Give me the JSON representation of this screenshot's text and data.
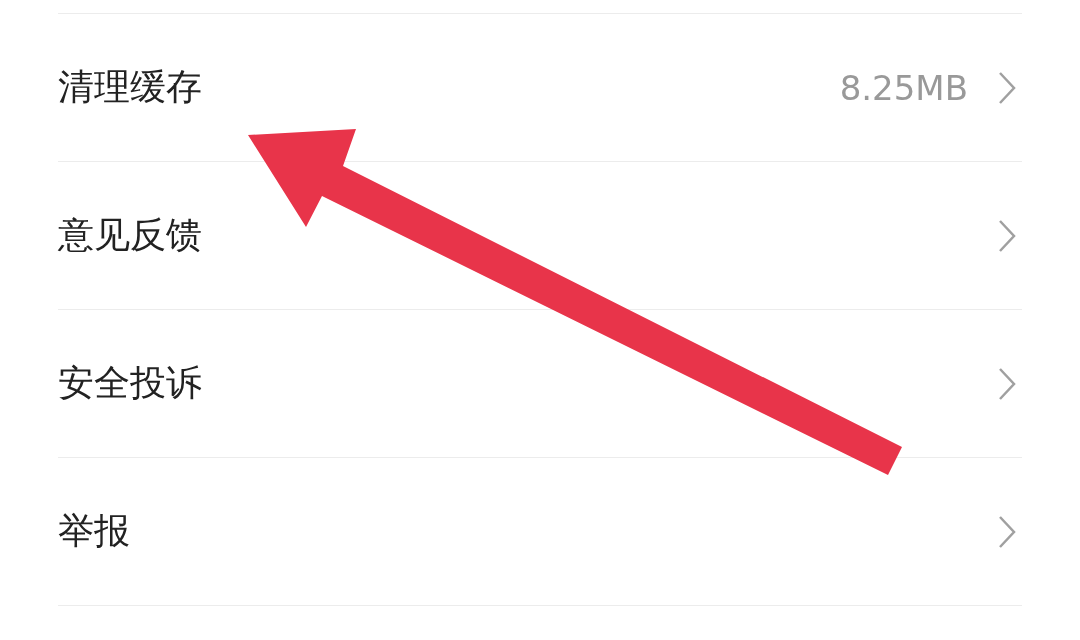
{
  "settings": [
    {
      "label": "清理缓存",
      "value": "8.25MB"
    },
    {
      "label": "意见反馈"
    },
    {
      "label": "安全投诉"
    },
    {
      "label": "举报"
    }
  ]
}
